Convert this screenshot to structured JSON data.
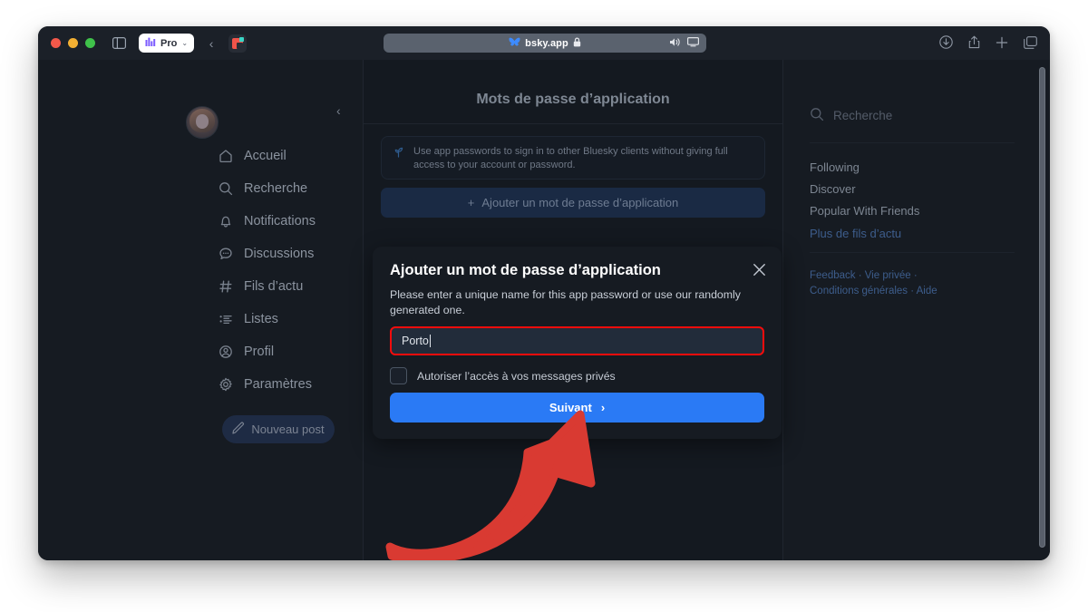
{
  "browser": {
    "tab_pill_label": "Pro",
    "tab_pill_icon": "bar-chart-icon",
    "tab_pill_chevron": "⌄",
    "back_chevron": "‹",
    "sidebar_toggle_icon": "sidebar-toggle-icon",
    "url_host": "bsky.app",
    "url_lock_icon": "🔒",
    "url_butterfly_icon": "✦",
    "url_sound_icon": "🔊",
    "url_screen_icon": "⬜",
    "toolbar_icons": [
      "download-icon",
      "share-icon",
      "new-tab-icon",
      "tabs-icon"
    ],
    "download_glyph": "↓",
    "share_glyph": "↑",
    "newtab_glyph": "+",
    "tabs_glyph": "❐"
  },
  "sidebar": {
    "collapse_chevron": "‹",
    "items": [
      {
        "label": "Accueil",
        "icon": "home-icon",
        "glyph": "⌂"
      },
      {
        "label": "Recherche",
        "icon": "search-icon",
        "glyph": "⚲"
      },
      {
        "label": "Notifications",
        "icon": "bell-icon",
        "glyph": "⍾"
      },
      {
        "label": "Discussions",
        "icon": "chat-icon",
        "glyph": "○"
      },
      {
        "label": "Fils d’actu",
        "icon": "hash-icon",
        "glyph": "#"
      },
      {
        "label": "Listes",
        "icon": "list-icon",
        "glyph": "≣"
      },
      {
        "label": "Profil",
        "icon": "profile-icon",
        "glyph": "◎"
      },
      {
        "label": "Paramètres",
        "icon": "gear-icon",
        "glyph": "⚙"
      }
    ],
    "new_post_label": "Nouveau post",
    "new_post_icon": "compose-icon",
    "new_post_glyph": "✎"
  },
  "main": {
    "title": "Mots de passe d’application",
    "info_icon": "sprout-icon",
    "info_glyph": "⚘",
    "info_text": "Use app passwords to sign in to other Bluesky clients without giving full access to your account or password.",
    "add_button_label": "Ajouter un mot de passe d’application",
    "add_button_icon": "plus-icon",
    "add_button_glyph": "+"
  },
  "right_sidebar": {
    "search_placeholder": "Recherche",
    "search_icon": "search-icon",
    "search_glyph": "⚲",
    "feeds": [
      {
        "label": "Following",
        "color": "#7d8692"
      },
      {
        "label": "Discover",
        "color": "#7d8692"
      },
      {
        "label": "Popular With Friends",
        "color": "#7d8692"
      },
      {
        "label": "Plus de fils d’actu",
        "color": "#3d5d8c"
      }
    ],
    "footer_line1": "Feedback · Vie privée ·",
    "footer_line2": "Conditions générales · Aide"
  },
  "modal": {
    "title": "Ajouter un mot de passe d’application",
    "close_icon": "close-icon",
    "close_glyph": "✕",
    "description": "Please enter a unique name for this app password or use our randomly generated one.",
    "input_value": "Porto",
    "input_placeholder": "",
    "checkbox_label": "Autoriser l’accès à vos messages privés",
    "checkbox_checked": false,
    "next_label": "Suivant",
    "next_chevron": "›"
  },
  "annotation": {
    "arrow_color": "#d93a32",
    "arrow_points_to": "Suivant"
  },
  "colors": {
    "accent_blue": "#2a7af5",
    "highlight_red": "#f50c0c",
    "window_bg": "#161b22",
    "center_bg": "#141920"
  }
}
